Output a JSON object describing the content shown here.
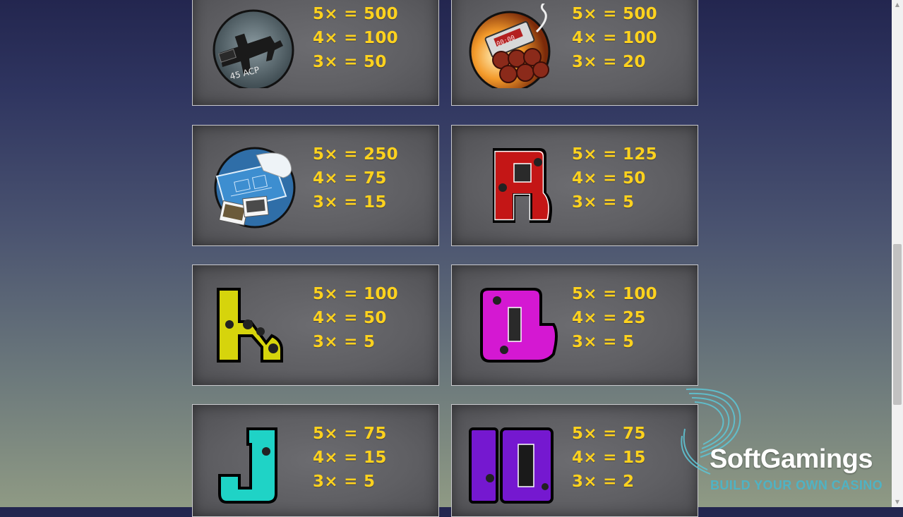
{
  "paytable": [
    {
      "symbol": "gun-icon",
      "pays": [
        "5× = 500",
        "4× = 100",
        "3× = 50"
      ],
      "label": "45 ACP"
    },
    {
      "symbol": "dynamite-bomb-icon",
      "pays": [
        "5× = 500",
        "4× = 100",
        "3× = 20"
      ],
      "label": "00:00"
    },
    {
      "symbol": "blueprint-icon",
      "pays": [
        "5× = 250",
        "4× = 75",
        "3× = 15"
      ]
    },
    {
      "symbol": "letter-a-icon",
      "letter": "A",
      "color": "#cc1111",
      "pays": [
        "5× = 125",
        "4× = 50",
        "3× = 5"
      ]
    },
    {
      "symbol": "letter-k-icon",
      "letter": "K",
      "color": "#d8d40a",
      "pays": [
        "5× = 100",
        "4× = 50",
        "3× = 5"
      ]
    },
    {
      "symbol": "letter-q-icon",
      "letter": "Q",
      "color": "#d21cd2",
      "pays": [
        "5× = 100",
        "4× = 25",
        "3× = 5"
      ]
    },
    {
      "symbol": "letter-j-icon",
      "letter": "J",
      "color": "#1bd8cc",
      "pays": [
        "5× = 75",
        "4× = 15",
        "3× = 5"
      ]
    },
    {
      "symbol": "number-10-icon",
      "letter": "10",
      "color": "#7a18d6",
      "pays": [
        "5× = 75",
        "4× = 15",
        "3× = 2"
      ]
    }
  ],
  "branding": {
    "name": "SoftGamings",
    "tagline": "BUILD YOUR OWN CASINO"
  },
  "colors": {
    "payout_text": "#ffd21e",
    "card_bg": "#5f5f63",
    "brand_accent": "#4fb3c4"
  }
}
